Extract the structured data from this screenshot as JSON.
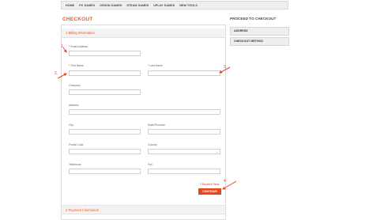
{
  "nav": {
    "items": [
      "HOME",
      "PC GAMES",
      "ORIGIN GAMES",
      "STEAM GAMES",
      "UPLAY GAMES",
      "NEW TOOLS"
    ]
  },
  "page": {
    "title": "CHECKOUT"
  },
  "billing": {
    "section_title": "1 Billing Information",
    "email_label": "Email Address",
    "first_name_label": "First Name",
    "last_name_label": "Last Name",
    "company_label": "Company",
    "address_label": "Address",
    "city_label": "City",
    "state_label": "State/Province",
    "postal_label": "Postal Code",
    "country_label": "Country",
    "telephone_label": "Telephone",
    "fax_label": "Fax",
    "required_symbol": "*",
    "required_note": "* Required Fields",
    "continue_label": "CONTINUE"
  },
  "payment": {
    "section_title": "2 Payment Information"
  },
  "sidebar": {
    "title": "PROCEED TO CHECKOUT",
    "items": [
      "ADDRESS",
      "CHECKOUT METHOD"
    ]
  },
  "annotations": {
    "markers": [
      "1.",
      "2.",
      "3.",
      "4."
    ],
    "color": "#e8471e"
  },
  "colors": {
    "accent": "#e85a2a",
    "button": "#e8471e"
  }
}
